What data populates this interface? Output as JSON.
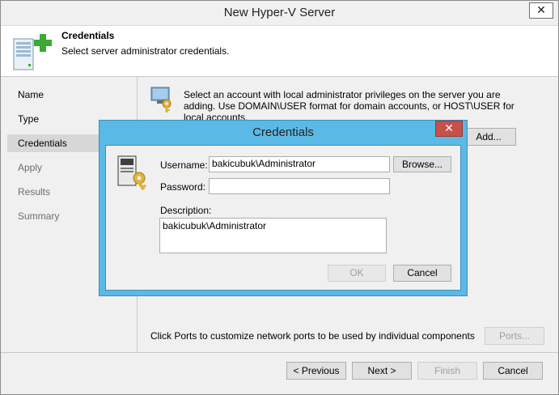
{
  "window": {
    "title": "New Hyper-V Server",
    "close_glyph": "✕"
  },
  "header": {
    "title": "Credentials",
    "subtitle": "Select server administrator credentials.",
    "icon": "server-add-icon"
  },
  "sidebar": {
    "items": [
      {
        "label": "Name",
        "state": "done"
      },
      {
        "label": "Type",
        "state": "done"
      },
      {
        "label": "Credentials",
        "state": "selected"
      },
      {
        "label": "Apply",
        "state": "pending"
      },
      {
        "label": "Results",
        "state": "pending"
      },
      {
        "label": "Summary",
        "state": "pending"
      }
    ]
  },
  "content": {
    "description": "Select an account with local administrator privileges on the server you are adding. Use DOMAIN\\USER format for domain accounts, or HOST\\USER for local accounts.",
    "add_label": "Add...",
    "ports_text": "Click Ports to customize network ports to be used by individual components",
    "ports_label": "Ports..."
  },
  "footer": {
    "previous_label": "< Previous",
    "next_label": "Next >",
    "finish_label": "Finish",
    "cancel_label": "Cancel"
  },
  "dialog": {
    "title": "Credentials",
    "close_glyph": "✕",
    "username_label": "Username:",
    "username_value": "bakicubuk\\Administrator",
    "browse_label": "Browse...",
    "password_label": "Password:",
    "password_value": "",
    "description_label": "Description:",
    "description_value": "bakicubuk\\Administrator",
    "ok_label": "OK",
    "cancel_label": "Cancel"
  },
  "colors": {
    "dialog_frame": "#5bb9e5",
    "dialog_close": "#c7504a",
    "selected_nav": "#d7d7d7",
    "plus_green": "#3aa935"
  }
}
